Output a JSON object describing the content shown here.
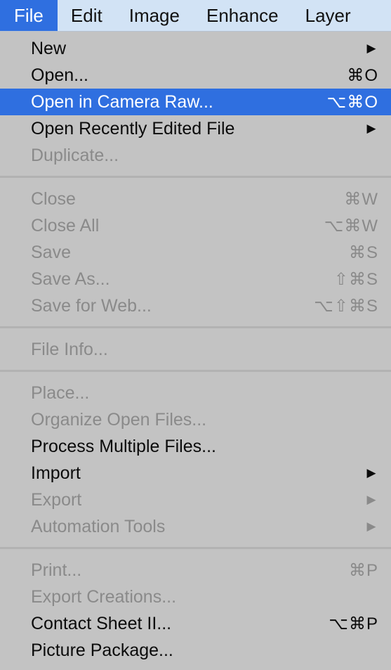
{
  "menubar": [
    {
      "label": "File",
      "active": true
    },
    {
      "label": "Edit"
    },
    {
      "label": "Image"
    },
    {
      "label": "Enhance"
    },
    {
      "label": "Layer"
    }
  ],
  "menu": {
    "group1": [
      {
        "label": "New",
        "submenu": "▶"
      },
      {
        "label": "Open...",
        "shortcut": "⌘O"
      },
      {
        "label": "Open in Camera Raw...",
        "shortcut": "⌥⌘O",
        "highlighted": true
      },
      {
        "label": "Open Recently Edited File",
        "submenu": "▶"
      },
      {
        "label": "Duplicate...",
        "disabled": true
      }
    ],
    "group2": [
      {
        "label": "Close",
        "shortcut": "⌘W",
        "disabled": true
      },
      {
        "label": "Close All",
        "shortcut": "⌥⌘W",
        "disabled": true
      },
      {
        "label": "Save",
        "shortcut": "⌘S",
        "disabled": true
      },
      {
        "label": "Save As...",
        "shortcut": "⇧⌘S",
        "disabled": true
      },
      {
        "label": "Save for Web...",
        "shortcut": "⌥⇧⌘S",
        "disabled": true
      }
    ],
    "group3": [
      {
        "label": "File Info...",
        "disabled": true
      }
    ],
    "group4": [
      {
        "label": "Place...",
        "disabled": true
      },
      {
        "label": "Organize Open Files...",
        "disabled": true
      },
      {
        "label": "Process Multiple Files..."
      },
      {
        "label": "Import",
        "submenu": "▶"
      },
      {
        "label": "Export",
        "submenu": "▶",
        "disabled": true
      },
      {
        "label": "Automation Tools",
        "submenu": "▶",
        "disabled": true
      }
    ],
    "group5": [
      {
        "label": "Print...",
        "shortcut": "⌘P",
        "disabled": true
      },
      {
        "label": "Export Creations...",
        "disabled": true
      },
      {
        "label": "Contact Sheet II...",
        "shortcut": "⌥⌘P"
      },
      {
        "label": "Picture Package..."
      }
    ]
  },
  "colors": {
    "menubar_bg": "#d2e3f5",
    "highlight": "#2f6fe0",
    "menu_bg": "#c3c3c3",
    "disabled_text": "#8a8a8a"
  }
}
